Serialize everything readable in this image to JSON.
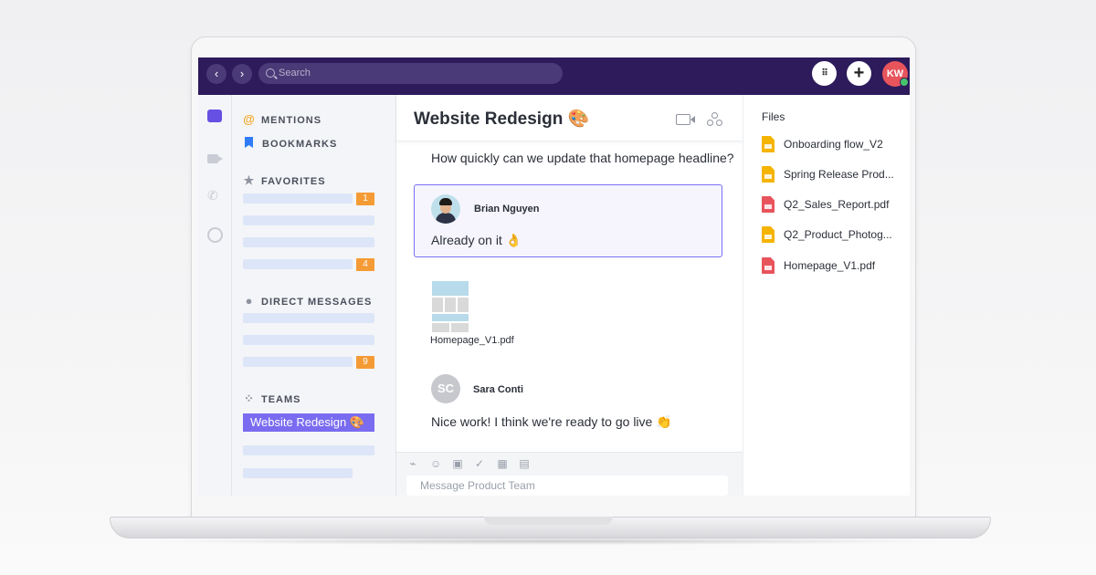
{
  "topbar": {
    "back_icon": "chevron-left-icon",
    "forward_icon": "chevron-right-icon",
    "search_placeholder": "Search",
    "dialpad_icon": "dialpad-icon",
    "add_icon": "plus-icon",
    "user_initials": "KW",
    "brand_color": "#2d1b5c"
  },
  "sidebar": {
    "mentions": "MENTIONS",
    "bookmarks": "BOOKMARKS",
    "favorites": "FAVORITES",
    "favorites_badges": [
      "1",
      "4"
    ],
    "direct_messages": "DIRECT MESSAGES",
    "dm_badges": [
      "9"
    ],
    "teams": "TEAMS",
    "active_team": "Website Redesign 🎨"
  },
  "chat": {
    "title": "Website Redesign 🎨",
    "messages": [
      {
        "sender": "",
        "text": "How quickly can we update that homepage headline?"
      },
      {
        "sender": "Brian Nguyen",
        "text": "Already on it 👌"
      },
      {
        "sender": "",
        "attachment": "Homepage_V1.pdf"
      },
      {
        "sender": "Sara Conti",
        "initials": "SC",
        "text": "Nice work! I think we're ready to go live 👏"
      }
    ],
    "composer_placeholder": "Message Product Team"
  },
  "files": {
    "title": "Files",
    "items": [
      {
        "name": "Onboarding flow_V2",
        "type": "slides",
        "color": "#f5b400"
      },
      {
        "name": "Spring Release Prod...",
        "type": "slides",
        "color": "#f5b400"
      },
      {
        "name": "Q2_Sales_Report.pdf",
        "type": "pdf",
        "color": "#e8545c"
      },
      {
        "name": "Q2_Product_Photog...",
        "type": "slides",
        "color": "#f5b400"
      },
      {
        "name": "Homepage_V1.pdf",
        "type": "pdf",
        "color": "#e8545c"
      }
    ]
  }
}
